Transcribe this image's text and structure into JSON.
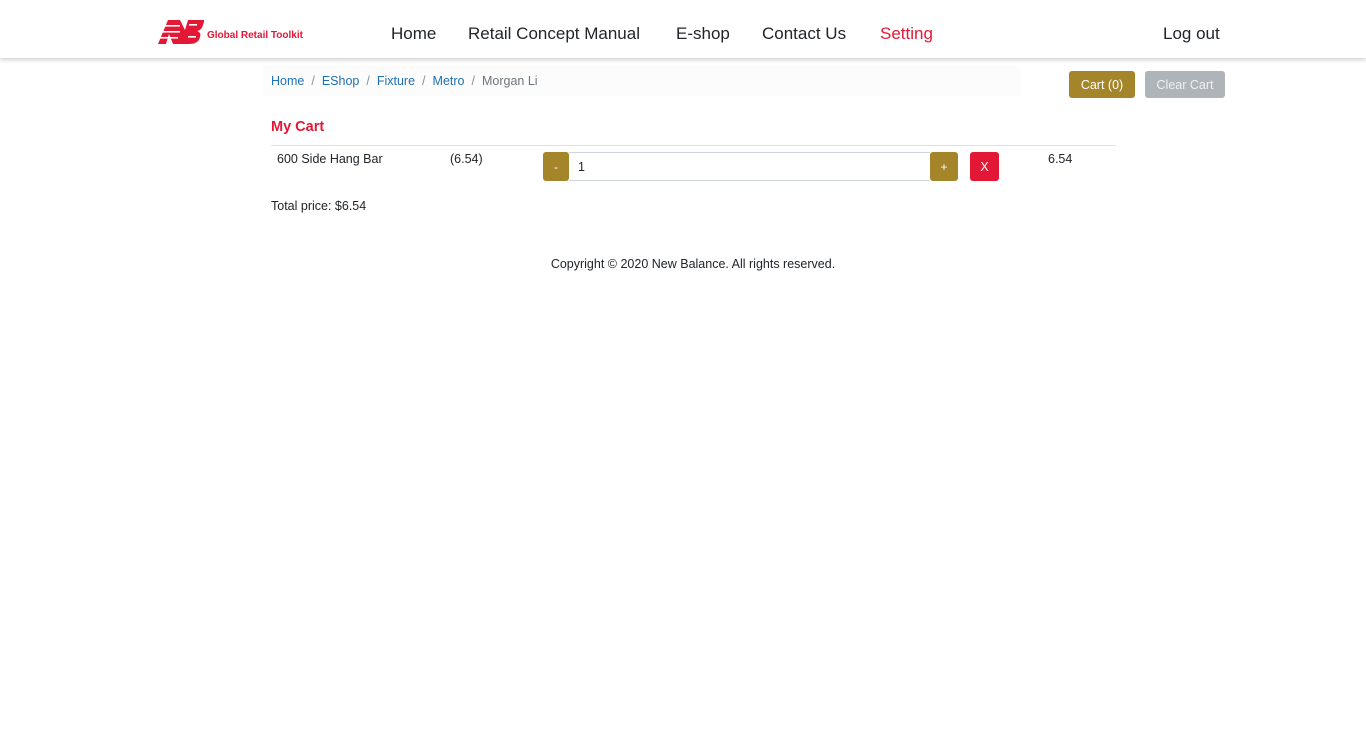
{
  "header": {
    "brand_text": "Global Retail Toolkit",
    "brand_logo_icon": "nb-logo-icon",
    "nav": [
      {
        "label": "Home"
      },
      {
        "label": "Retail Concept Manual"
      },
      {
        "label": "E-shop"
      },
      {
        "label": "Contact Us"
      },
      {
        "label": "Setting",
        "active": true
      }
    ],
    "logout_label": "Log out"
  },
  "breadcrumb": {
    "items": [
      "Home",
      "EShop",
      "Fixture",
      "Metro"
    ],
    "separator": "/",
    "current": "Morgan Li"
  },
  "cart_actions": {
    "cart_label": "Cart (0)",
    "clear_label": "Clear Cart"
  },
  "cart": {
    "title": "My Cart",
    "items": [
      {
        "name": "600 Side Hang Bar",
        "unit_price": "(6.54)",
        "decrement_label": "-",
        "quantity": "1",
        "increment_label": "+",
        "remove_label": "X",
        "line_total": "6.54"
      }
    ],
    "total_text": "Total price: $6.54"
  },
  "footer": {
    "copyright": "Copyright © 2020 New Balance. All rights reserved."
  },
  "colors": {
    "brand_red": "#e21836",
    "gold": "#a5852a",
    "link_blue": "#1f6fb2",
    "disabled_gray": "#afb4b9"
  }
}
